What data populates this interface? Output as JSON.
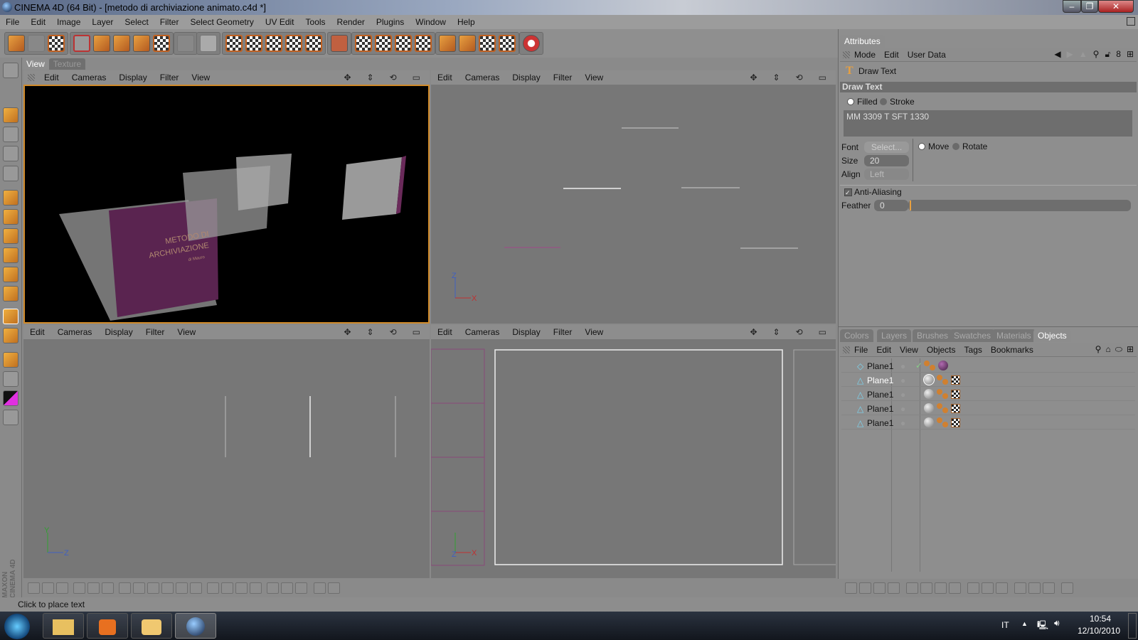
{
  "window": {
    "title": "CINEMA 4D (64 Bit) - [metodo di archiviazione animato.c4d *]"
  },
  "menubar": [
    "File",
    "Edit",
    "Image",
    "Layer",
    "Select",
    "Filter",
    "Select Geometry",
    "UV Edit",
    "Tools",
    "Render",
    "Plugins",
    "Window",
    "Help"
  ],
  "view_tabs": [
    "View",
    "Texture"
  ],
  "viewport_menu": [
    "Edit",
    "Cameras",
    "Display",
    "Filter",
    "View"
  ],
  "scene": {
    "text_line1": "METODO DI",
    "text_line2": "ARCHIVIAZIONE",
    "text_line3": "di Mauro"
  },
  "axes": {
    "x": "X",
    "y": "Y",
    "z": "Z"
  },
  "attributes": {
    "tab": "Attributes",
    "menu": [
      "Mode",
      "Edit",
      "User Data"
    ],
    "tool_name": "Draw Text",
    "section": "Draw Text",
    "filled_label": "Filled",
    "stroke_label": "Stroke",
    "text_value": "MM 3309 T SFT 1330",
    "font_label": "Font",
    "font_button": "Select...",
    "size_label": "Size",
    "size_value": "20",
    "align_label": "Align",
    "align_value": "Left",
    "move_label": "Move",
    "rotate_label": "Rotate",
    "antialias_label": "Anti-Aliasing",
    "antialias_checked": true,
    "feather_label": "Feather",
    "feather_value": "0"
  },
  "objects_panel": {
    "tabs": [
      "Colors",
      "Layers",
      "Brushes",
      "Swatches",
      "Materials",
      "Objects"
    ],
    "active_tab": "Objects",
    "menu": [
      "File",
      "Edit",
      "View",
      "Objects",
      "Tags",
      "Bookmarks"
    ],
    "rows": [
      {
        "name": "Plane1"
      },
      {
        "name": "Plane1"
      },
      {
        "name": "Plane1"
      },
      {
        "name": "Plane1"
      },
      {
        "name": "Plane1"
      }
    ]
  },
  "brand": "MAXON CINEMA 4D",
  "status": "Click to place text",
  "taskbar": {
    "language": "IT",
    "time": "10:54",
    "date": "12/10/2010"
  },
  "colors": {
    "accent": "#e8a040",
    "active_viewport_border": "#d08a2a",
    "plane_purple": "#6a2a5a"
  }
}
